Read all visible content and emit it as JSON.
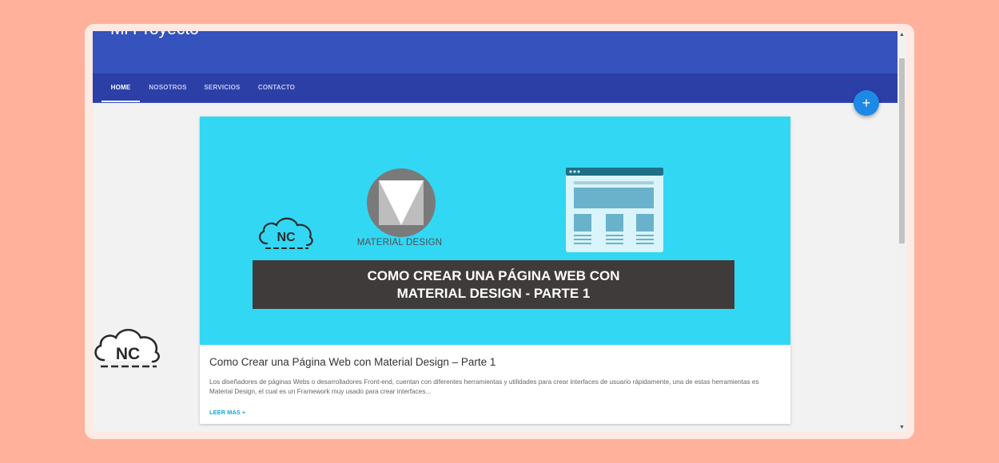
{
  "app": {
    "brand": "Mi Proyecto"
  },
  "nav": {
    "tabs": [
      {
        "label": "HOME",
        "active": true
      },
      {
        "label": "NOSOTROS",
        "active": false
      },
      {
        "label": "SERVICIOS",
        "active": false
      },
      {
        "label": "CONTACTO",
        "active": false
      }
    ]
  },
  "fab": {
    "label": "+"
  },
  "card": {
    "image": {
      "logo_text": "NC",
      "md_label": "MATERIAL DESIGN",
      "banner_line1": "COMO CREAR UNA PÁGINA WEB CON",
      "banner_line2": "MATERIAL DESIGN - PARTE 1",
      "bg_color": "#32d7f4"
    },
    "title": "Como Crear una Página Web con Material Design – Parte 1",
    "text": "Los diseñadores de páginas Webs o desarrolladores Front-end, cuentan con diferentes herramientas y utilidades para crear interfaces de usuario rápidamente, una de estas herramientas es Material Design, el cual es un Framework muy usado para crear interfaces...",
    "action": "LEER MAS +"
  },
  "watermark": {
    "text": "NC"
  },
  "colors": {
    "appbar": "#3652bc",
    "tabs": "#2b3fa7",
    "fab": "#1e88e5",
    "background": "#ffb19c"
  }
}
